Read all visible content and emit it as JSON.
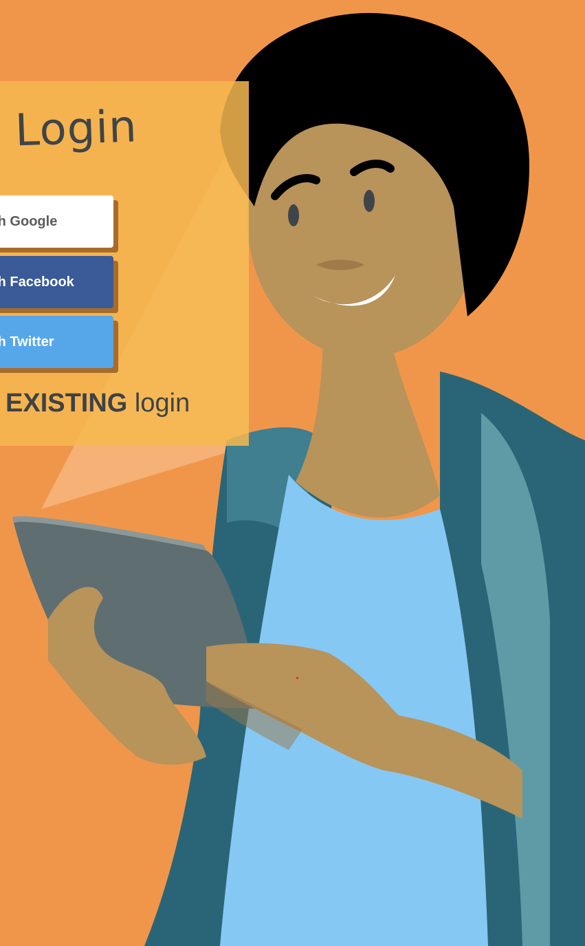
{
  "login": {
    "title": "Login",
    "buttons": [
      {
        "label": "th Google"
      },
      {
        "label": "th Facebook"
      },
      {
        "label": "th Twitter"
      }
    ],
    "existing_bold": "EXISTING",
    "existing_rest": " login"
  },
  "colors": {
    "background": "#f0964a",
    "panel": "#f6b950",
    "google": "#ffffff",
    "facebook": "#3a5a98",
    "twitter": "#56a7ea",
    "skin": "#b8935a",
    "hair": "#000000",
    "jacket": "#2a6577",
    "shirt": "#86c8f4",
    "tablet": "#5f6e70"
  },
  "icons": [
    "woman-illustration",
    "tablet-device"
  ]
}
